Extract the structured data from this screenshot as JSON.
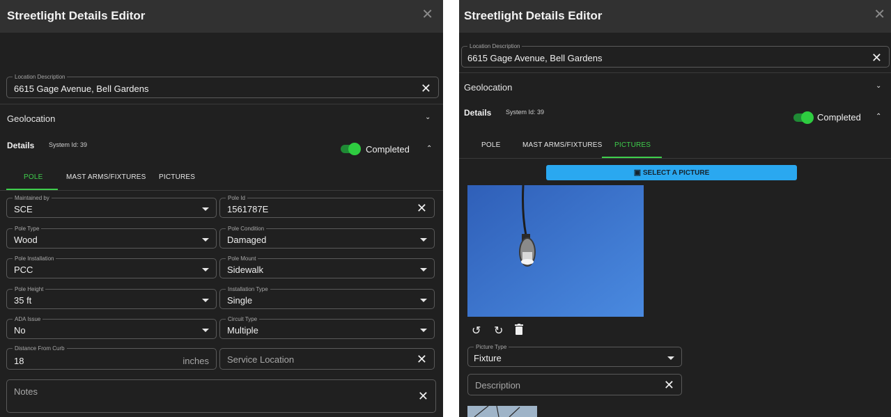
{
  "left": {
    "title": "Streetlight Details Editor",
    "close": "✕",
    "location": {
      "label": "Location Description",
      "value": "6615 Gage Avenue, Bell Gardens",
      "clear": "✕"
    },
    "geolocation": {
      "label": "Geolocation",
      "chevron": "⌄"
    },
    "details": {
      "label": "Details",
      "system_id": "System Id: 39",
      "completed": "Completed",
      "chevron": "⌃"
    },
    "tabs": [
      "POLE",
      "MAST ARMS/FIXTURES",
      "PICTURES"
    ],
    "fields": {
      "maintained_by": {
        "label": "Maintained by",
        "value": "SCE"
      },
      "pole_id": {
        "label": "Pole Id",
        "value": "1561787E",
        "clear": "✕"
      },
      "pole_type": {
        "label": "Pole Type",
        "value": "Wood"
      },
      "pole_condition": {
        "label": "Pole Condition",
        "value": "Damaged"
      },
      "pole_installation": {
        "label": "Pole Installation",
        "value": "PCC"
      },
      "pole_mount": {
        "label": "Pole Mount",
        "value": "Sidewalk"
      },
      "pole_height": {
        "label": "Pole Height",
        "value": "35 ft"
      },
      "installation_type": {
        "label": "Installation Type",
        "value": "Single"
      },
      "ada_issue": {
        "label": "ADA Issue",
        "value": "No"
      },
      "circuit_type": {
        "label": "Circuit Type",
        "value": "Multiple"
      },
      "distance_from_curb": {
        "label": "Distance From Curb",
        "value": "18",
        "unit": "inches"
      },
      "service_location": {
        "placeholder": "Service Location",
        "clear": "✕"
      },
      "notes": {
        "placeholder": "Notes",
        "clear": "✕"
      }
    }
  },
  "right": {
    "title": "Streetlight Details Editor",
    "close": "✕",
    "location": {
      "label": "Location Description",
      "value": "6615 Gage Avenue, Bell Gardens",
      "clear": "✕"
    },
    "geolocation": {
      "label": "Geolocation",
      "chevron": "⌄"
    },
    "details": {
      "label": "Details",
      "system_id": "System Id: 39",
      "completed": "Completed",
      "chevron": "⌃"
    },
    "tabs": [
      "POLE",
      "MAST ARMS/FIXTURES",
      "PICTURES"
    ],
    "select_picture": "SELECT A PICTURE",
    "tools": {
      "rotate_left": "↺",
      "rotate_right": "↻",
      "delete": "🗑"
    },
    "picture_type": {
      "label": "Picture Type",
      "value": "Fixture"
    },
    "description": {
      "placeholder": "Description",
      "clear": "✕"
    }
  },
  "colors": {
    "accent_green": "#3fcf4c",
    "button_blue": "#2aa8f0",
    "panel_bg": "#202020",
    "titlebar_bg": "#313131"
  },
  "icons": [
    "close-icon",
    "chevron-down-icon",
    "chevron-up-icon",
    "camera-icon",
    "rotate-left-icon",
    "rotate-right-icon",
    "trash-icon"
  ]
}
